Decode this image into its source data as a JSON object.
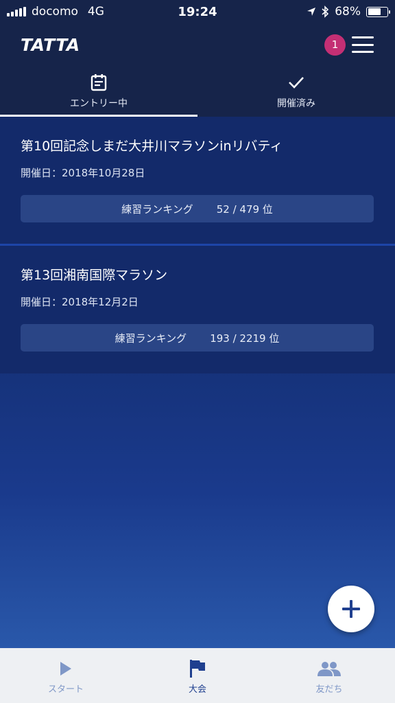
{
  "status_bar": {
    "carrier": "docomo",
    "network": "4G",
    "time": "19:24",
    "battery": "68%",
    "battery_level": 0.68
  },
  "header": {
    "logo": "TATTA",
    "notification_count": "1",
    "badge_color": "#c42f74"
  },
  "tabs": [
    {
      "label": "エントリー中",
      "icon": "calendar-icon",
      "active": true
    },
    {
      "label": "開催済み",
      "icon": "check-icon",
      "active": false
    }
  ],
  "events": [
    {
      "title": "第10回記念しまだ大井川マラソンinリバティ",
      "date": "開催日：2018年10月28日",
      "ranking_label": "練習ランキング",
      "ranking_value": "52 / 479 位"
    },
    {
      "title": "第13回湘南国際マラソン",
      "date": "開催日：2018年12月2日",
      "ranking_label": "練習ランキング",
      "ranking_value": "193 / 2219 位"
    }
  ],
  "fab": {
    "icon": "plus-icon"
  },
  "bottom_nav": [
    {
      "label": "スタート",
      "icon": "play-icon",
      "active": false
    },
    {
      "label": "大会",
      "icon": "flag-icon",
      "active": true
    },
    {
      "label": "友だち",
      "icon": "people-icon",
      "active": false
    }
  ],
  "colors": {
    "header_bg": "#16244a",
    "card_bg": "#132a6a",
    "accent_blue": "#1f3f8f",
    "nav_bg": "#eef0f3"
  }
}
